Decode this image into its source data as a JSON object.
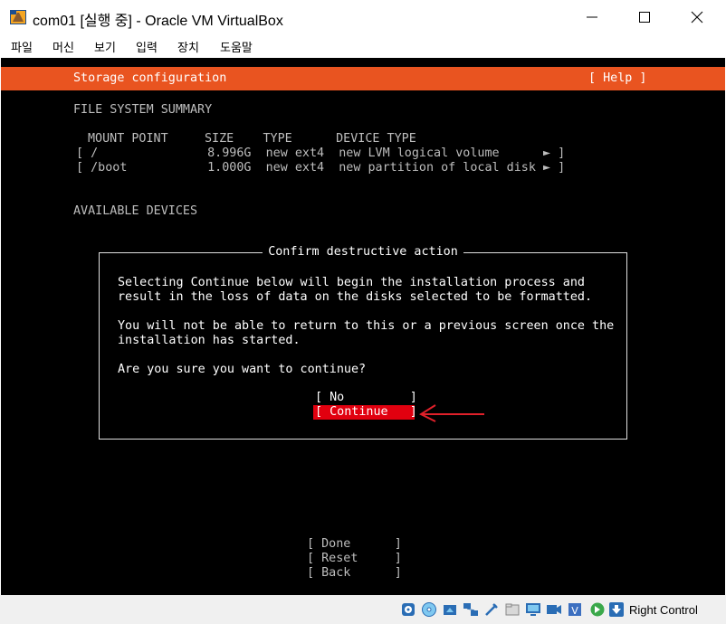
{
  "window": {
    "title": "com01 [실행 중] - Oracle VM VirtualBox",
    "controls": [
      "minimize-icon",
      "maximize-icon",
      "close-icon"
    ]
  },
  "menu": [
    "파일",
    "머신",
    "보기",
    "입력",
    "장치",
    "도움말"
  ],
  "screen": {
    "header_title": "Storage configuration",
    "help": "[ Help ]",
    "fs_summary_title": "FILE SYSTEM SUMMARY",
    "columns_line": "MOUNT POINT     SIZE    TYPE      DEVICE TYPE",
    "rows": [
      "[ /               8.996G  new ext4  new LVM logical volume      ► ]",
      "[ /boot           1.000G  new ext4  new partition of local disk ► ]"
    ],
    "available_devices": "AVAILABLE DEVICES",
    "dialog": {
      "title": "Confirm destructive action",
      "paragraph1": [
        "Selecting Continue below will begin the installation process and",
        "result in the loss of data on the disks selected to be formatted."
      ],
      "paragraph2": [
        "You will not be able to return to this or a previous screen once the",
        "installation has started."
      ],
      "question": "Are you sure you want to continue?",
      "no_button": "[ No         ]",
      "continue_button": "[ Continue   ]"
    },
    "bottom_buttons": [
      "[ Done      ]",
      "[ Reset     ]",
      "[ Back      ]"
    ]
  },
  "statusbar": {
    "host_key": "Right Control",
    "icons": [
      "hard-disk-icon",
      "optical-drive-icon",
      "audio-icon",
      "network-icon",
      "usb-icon",
      "shared-folders-icon",
      "display-icon",
      "video-capture-icon",
      "recording-icon",
      "cpu-icon",
      "mouse-integration-icon",
      "keyboard-arrow-icon"
    ]
  },
  "colors": {
    "header_orange": "#e95420",
    "selected_red": "#e1000f",
    "annotation_arrow": "#e0202a"
  }
}
